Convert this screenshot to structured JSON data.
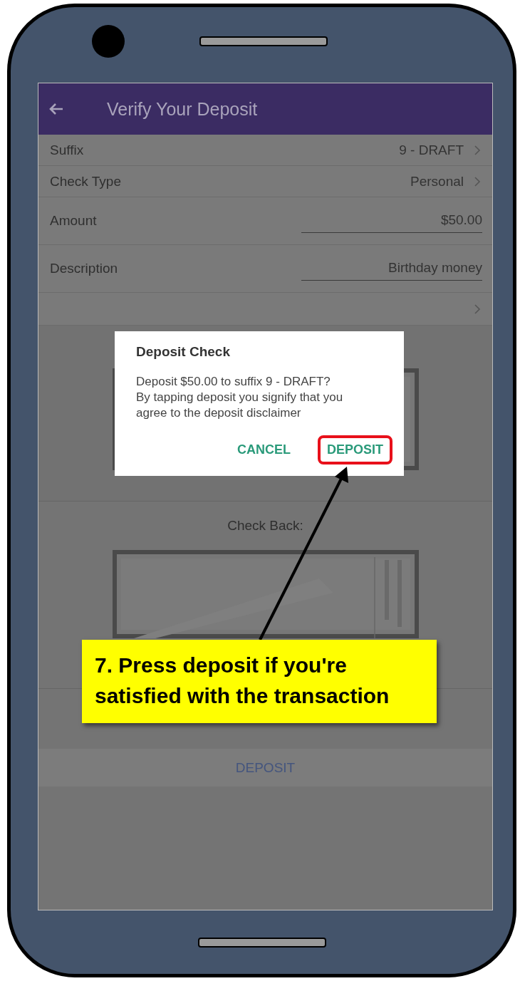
{
  "header": {
    "title": "Verify Your Deposit"
  },
  "rows": [
    {
      "kind": "select",
      "label": "Suffix",
      "value": "9 - DRAFT"
    },
    {
      "kind": "select",
      "label": "Check Type",
      "value": "Personal"
    },
    {
      "kind": "input",
      "label": "Amount",
      "value": "$50.00"
    },
    {
      "kind": "input",
      "label": "Description",
      "value": "Birthday money"
    },
    {
      "kind": "chevron_only"
    }
  ],
  "check_back_label": "Check Back:",
  "deposit_button": "DEPOSIT",
  "dialog": {
    "title": "Deposit Check",
    "message": [
      "Deposit $50.00 to suffix 9 - DRAFT?",
      "By tapping deposit you signify that you agree to the deposit disclaimer"
    ],
    "buttons": [
      {
        "label": "CANCEL",
        "highlighted": false
      },
      {
        "label": "DEPOSIT",
        "highlighted": true
      }
    ]
  },
  "callout": {
    "text": "7. Press deposit if you're satisfied with the transaction"
  }
}
